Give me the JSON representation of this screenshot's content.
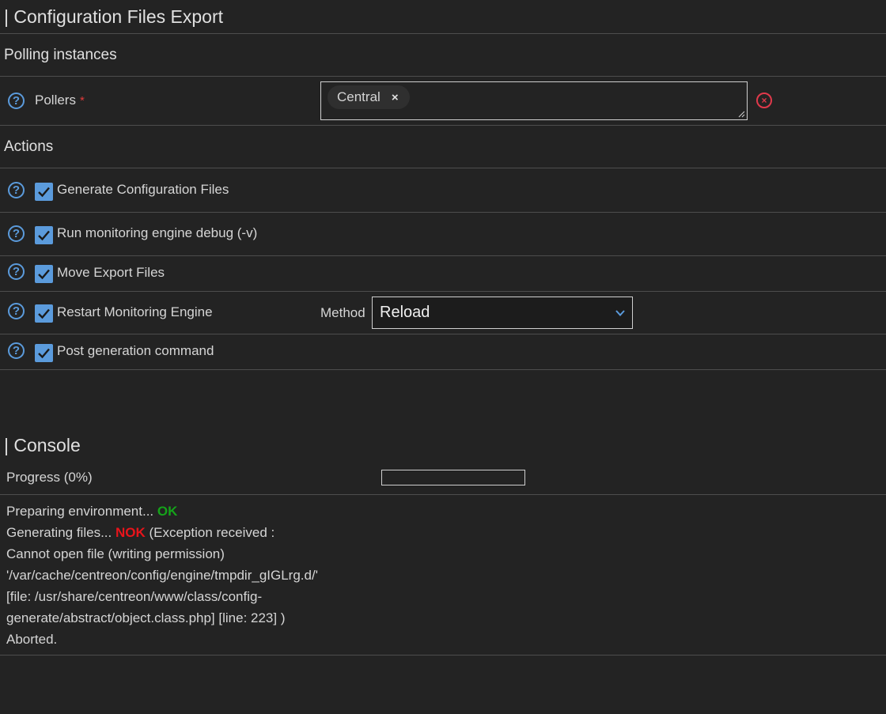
{
  "page": {
    "title": "| Configuration Files Export"
  },
  "polling": {
    "section_label": "Polling instances",
    "pollers_label": "Pollers",
    "required_mark": "*",
    "selected": [
      {
        "label": "Central",
        "remove": "×"
      }
    ],
    "clear_icon": "×"
  },
  "actions": {
    "section_label": "Actions",
    "items": [
      {
        "label": "Generate Configuration Files",
        "checked": true
      },
      {
        "label": "Run monitoring engine debug (-v)",
        "checked": true
      },
      {
        "label": "Move Export Files",
        "checked": true
      },
      {
        "label": "Restart Monitoring Engine",
        "checked": true
      },
      {
        "label": "Post generation command",
        "checked": true
      }
    ],
    "method_label": "Method",
    "method_value": "Reload"
  },
  "console": {
    "title": "| Console",
    "progress_label": "Progress (0%)",
    "progress_fraction": 0,
    "lines": {
      "line1_text": "Preparing environment... ",
      "line1_status": "OK",
      "line2_text": "Generating files... ",
      "line2_status": "NOK",
      "line2_rest": " (Exception received :",
      "line3": "Cannot open file (writing permission)",
      "line4": "'/var/cache/centreon/config/engine/tmpdir_gIGLrg.d/'",
      "line5": "[file: /usr/share/centreon/www/class/config-",
      "line6": "generate/abstract/object.class.php] [line: 223] )",
      "line7": "Aborted."
    }
  },
  "colors": {
    "background": "#232323",
    "accent": "#5b9bdc",
    "ok": "#15a31a",
    "nok": "#e8141b",
    "required": "#e03a3a"
  },
  "icons": {
    "help": "question-circle-icon",
    "check": "check-icon",
    "clear": "close-circle-icon",
    "chevron": "chevron-down-icon"
  }
}
